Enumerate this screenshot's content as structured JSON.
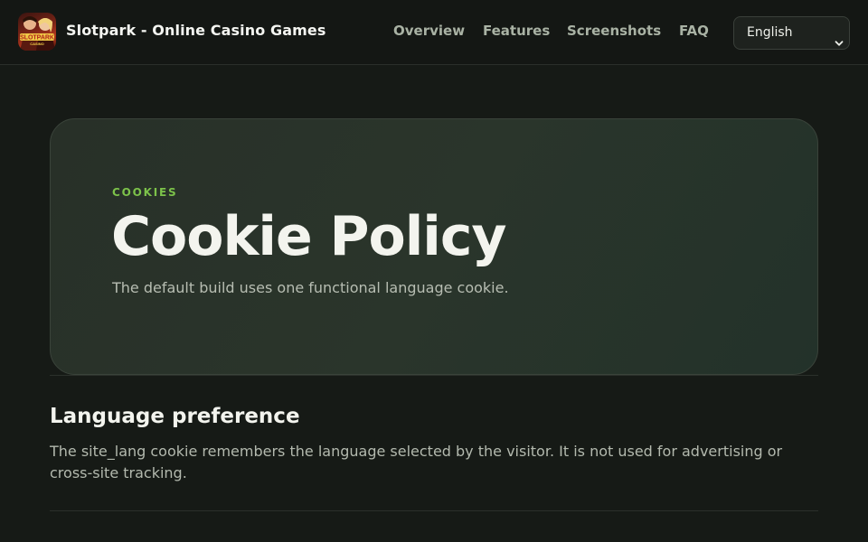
{
  "header": {
    "brand": "Slotpark - Online Casino Games",
    "logo_text_top": "SLOTPARK",
    "logo_text_bottom": "CASINO",
    "nav": [
      {
        "label": "Overview"
      },
      {
        "label": "Features"
      },
      {
        "label": "Screenshots"
      },
      {
        "label": "FAQ"
      }
    ],
    "language_select": {
      "selected": "English",
      "icon": "chevron-down-icon"
    }
  },
  "hero": {
    "eyebrow": "COOKIES",
    "title": "Cookie Policy",
    "subtitle": "The default build uses one functional language cookie."
  },
  "section": {
    "title": "Language preference",
    "body": "The site_lang cookie remembers the language selected by the visitor. It is not used for advertising or cross-site tracking."
  },
  "colors": {
    "background": "#161a16",
    "accent": "#7cc24a",
    "text": "#eef0ea",
    "muted_text": "#b3b9ae"
  }
}
